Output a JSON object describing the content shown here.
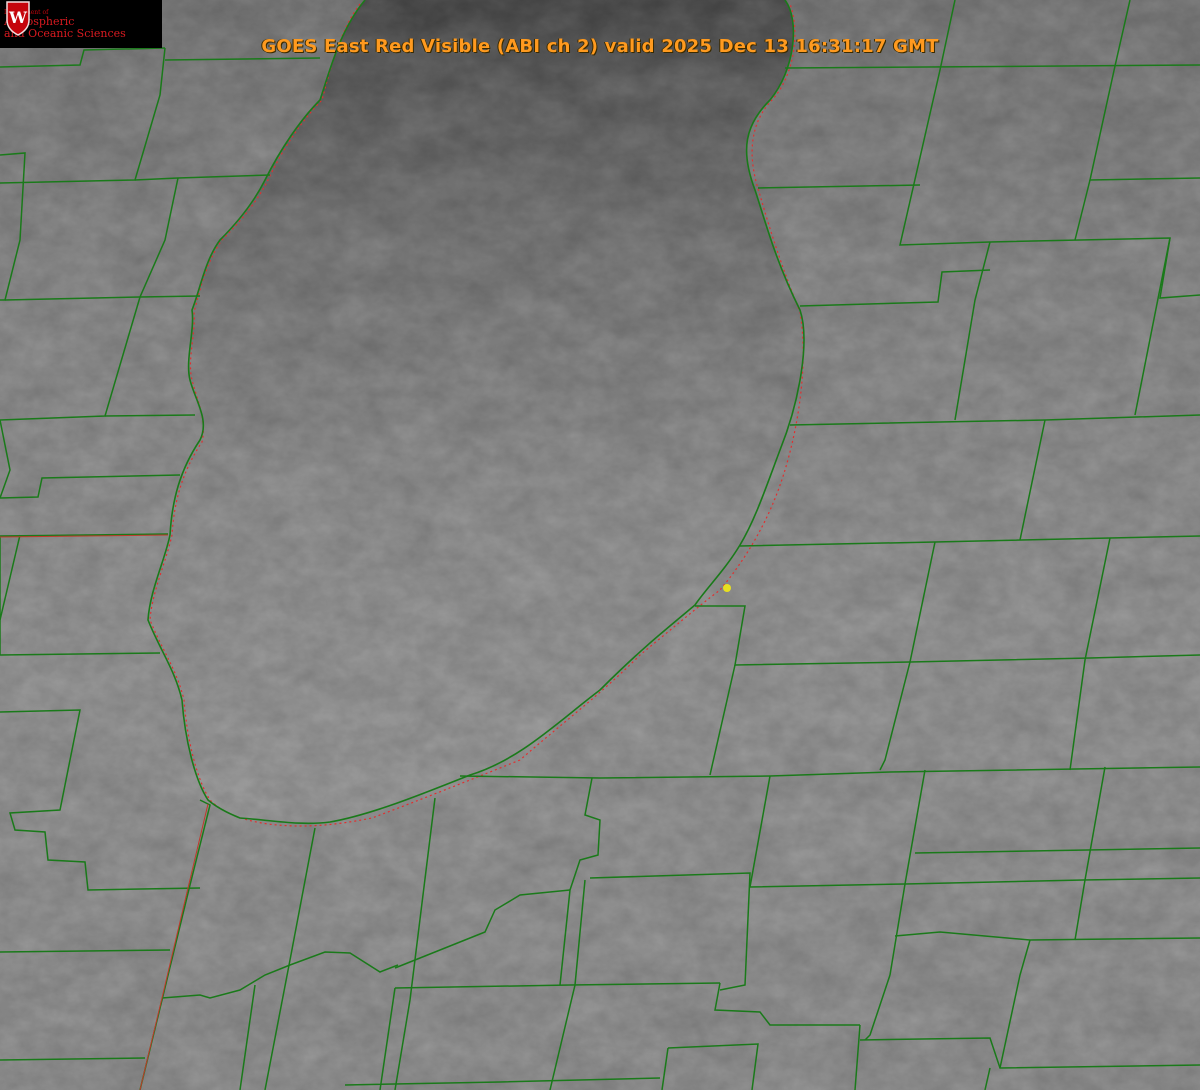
{
  "title": "GOES East Red Visible (ABI ch 2) valid 2025 Dec 13 16:31:17 GMT",
  "logo": {
    "line1": "Department of",
    "line2": "Atmospheric",
    "line3": "and Oceanic Sciences",
    "crest_letter": "W"
  },
  "colors": {
    "county_lines": "#1a7a1a",
    "shoreline_dotted": "#e03030",
    "title_text": "#ff9a1f",
    "marker": "#e8e020",
    "logo_red": "#c5050c"
  },
  "icons": [
    "university-crest-icon",
    "location-marker-icon"
  ]
}
